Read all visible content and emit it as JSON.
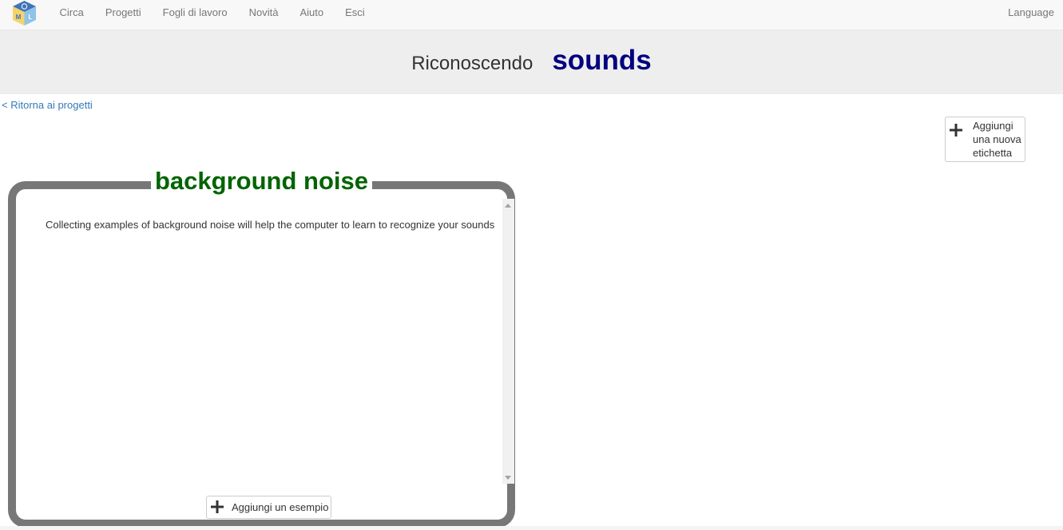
{
  "nav": {
    "items": [
      {
        "label": "Circa"
      },
      {
        "label": "Progetti"
      },
      {
        "label": "Fogli di lavoro"
      },
      {
        "label": "Novità"
      },
      {
        "label": "Aiuto"
      },
      {
        "label": "Esci"
      }
    ],
    "language": "Language",
    "logo_letters": [
      "M",
      "L"
    ]
  },
  "header": {
    "label": "Riconoscendo",
    "project": "sounds"
  },
  "back_link": "< Ritorna ai progetti",
  "add_label_button": {
    "label": "Aggiungi una nuova etichetta",
    "icon": "plus-icon"
  },
  "label_card": {
    "title": "background noise",
    "help_text": "Collecting examples of background noise will help the computer to learn to recognize your sounds",
    "add_example_button": "Aggiungi un esempio",
    "icon": "plus-icon"
  },
  "colors": {
    "project_name": "#000080",
    "label_title": "#006400",
    "card_border": "#777777",
    "link": "#337ab7"
  }
}
